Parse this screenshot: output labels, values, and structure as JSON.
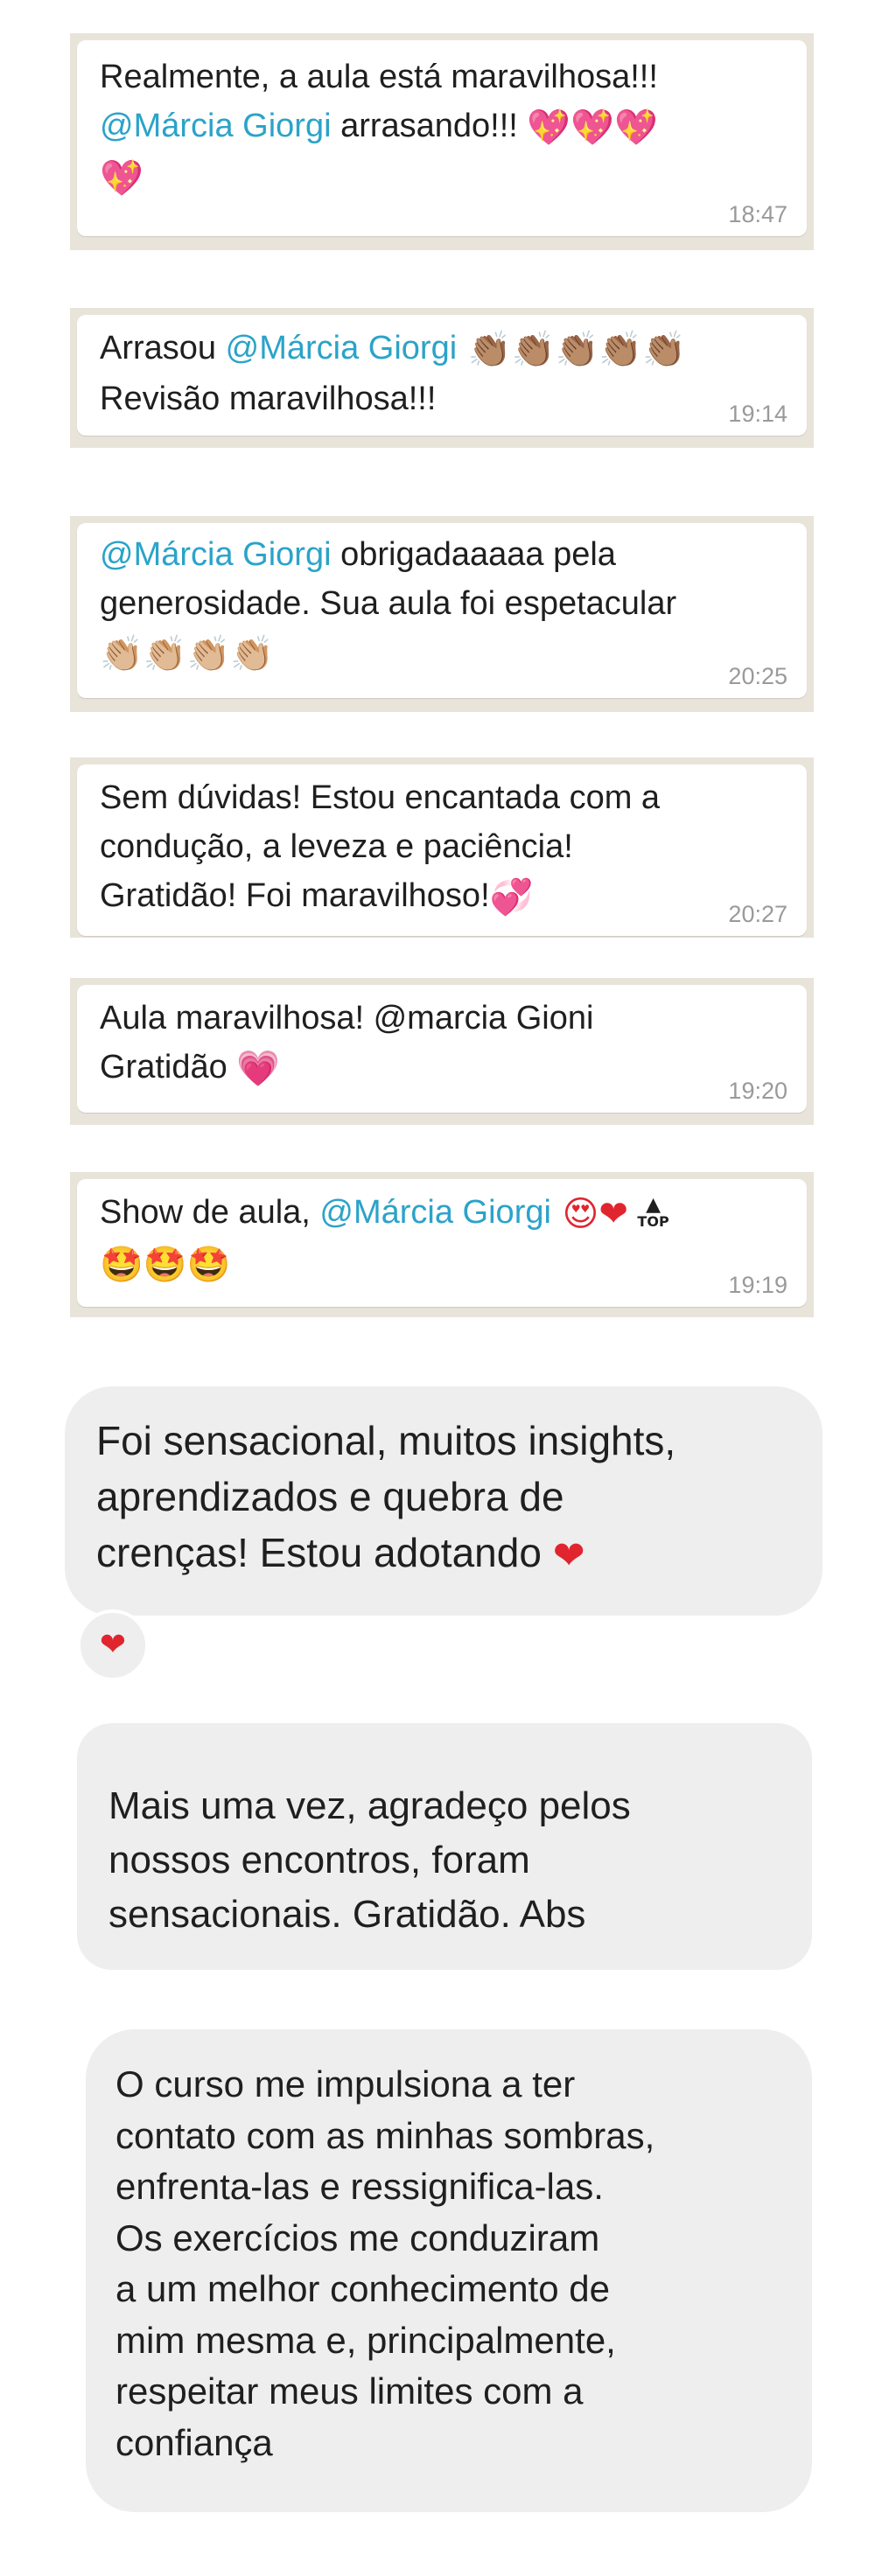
{
  "messages": [
    {
      "line1": "Realmente, a aula está maravilhosa!!!",
      "mention": "@Márcia Giorgi",
      "after_mention": " arrasando!!! ",
      "emojis": "💖💖💖",
      "line3_emoji": "💖",
      "time": "18:47"
    },
    {
      "before_mention": "Arrasou ",
      "mention": "@Márcia Giorgi",
      "emojis": " 👏🏽👏🏽👏🏽👏🏽👏🏽",
      "line2": "Revisão maravilhosa!!!",
      "time": "19:14"
    },
    {
      "mention": "@Márcia Giorgi",
      "after_mention": " obrigadaaaaa pela",
      "line2": "generosidade. Sua aula foi espetacular",
      "emojis": "👏🏼👏🏼👏🏼👏🏼",
      "time": "20:25"
    },
    {
      "line1": "Sem dúvidas! Estou encantada com a",
      "line2": "condução, a leveza e paciência!",
      "line3": "Gratidão! Foi maravilhoso!",
      "emoji": "💞",
      "time": "20:27"
    },
    {
      "line1": "Aula maravilhosa! @marcia Gioni",
      "line2": "Gratidão ",
      "emoji": "💗",
      "time": "19:20"
    },
    {
      "before_mention": "Show de aula, ",
      "mention": "@Márcia Giorgi",
      "emojis": " 😍❤",
      "top_label": "TOP",
      "line2_emojis": "🤩🤩🤩",
      "time": "19:19"
    }
  ],
  "gray_messages": [
    {
      "line1": "Foi sensacional, muitos insights,",
      "line2": "aprendizados e quebra de",
      "line3": "crenças! Estou adotando ",
      "emoji": "❤",
      "reaction": "❤"
    },
    {
      "line1": "Mais uma vez, agradeço pelos",
      "line2": "nossos encontros, foram",
      "line3": "sensacionais. Gratidão. Abs"
    },
    {
      "lines": [
        "O curso me impulsiona a ter",
        "contato com as minhas sombras,",
        "enfrenta-las e ressignifica-las.",
        "Os exercícios me conduziram",
        "a um melhor conhecimento de",
        "mim mesma e, principalmente,",
        "respeitar meus limites com a",
        "confiança"
      ]
    }
  ]
}
